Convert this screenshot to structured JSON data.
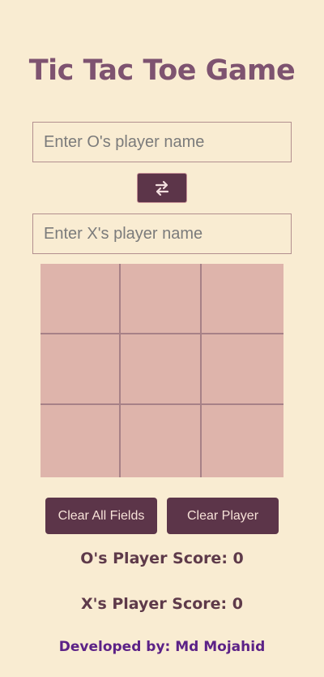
{
  "title": "Tic Tac Toe Game",
  "inputs": {
    "o_placeholder": "Enter O's player name",
    "x_placeholder": "Enter X's player name",
    "o_value": "",
    "x_value": ""
  },
  "swap_button": {
    "icon": "swap-arrows-icon"
  },
  "board": {
    "cells": [
      "",
      "",
      "",
      "",
      "",
      "",
      "",
      "",
      ""
    ]
  },
  "buttons": {
    "clear_fields": "Clear All Fields",
    "clear_player": "Clear Player"
  },
  "scores": {
    "o_text": "O's Player Score: 0",
    "x_text": "X's Player Score: 0"
  },
  "footer": "Developed by: Md Mojahid",
  "colors": {
    "background": "#f9ecd2",
    "title": "#7e5370",
    "button": "#5c3549",
    "board": "#deb4ab",
    "grid_line": "#a78187",
    "footer": "#5c2287"
  }
}
